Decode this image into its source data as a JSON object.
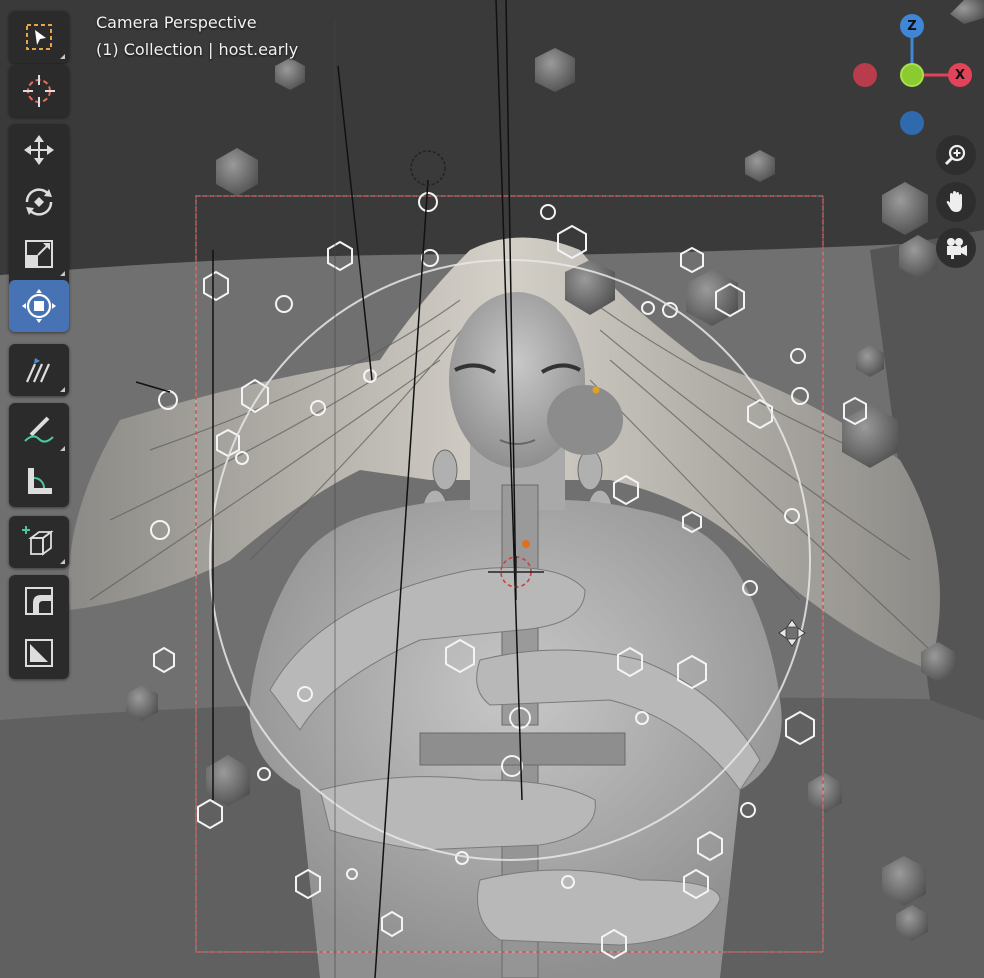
{
  "viewport": {
    "title": "Camera Perspective",
    "subtitle": "(1) Collection | host.early"
  },
  "toolbar": {
    "tools": [
      {
        "name": "select-box-tool",
        "icon": "select-box-icon",
        "active": false
      },
      {
        "name": "cursor-tool",
        "icon": "cursor-icon",
        "active": false
      },
      {
        "name": "move-tool",
        "icon": "move-icon",
        "active": false
      },
      {
        "name": "rotate-tool",
        "icon": "rotate-icon",
        "active": false
      },
      {
        "name": "scale-tool",
        "icon": "scale-icon",
        "active": false
      },
      {
        "name": "transform-tool",
        "icon": "transform-icon",
        "active": true
      },
      {
        "name": "hair-comb-tool",
        "icon": "comb-icon",
        "active": false
      },
      {
        "name": "annotate-tool",
        "icon": "annotate-icon",
        "active": false
      },
      {
        "name": "measure-tool",
        "icon": "measure-icon",
        "active": false
      },
      {
        "name": "add-cube-tool",
        "icon": "add-cube-icon",
        "active": false
      },
      {
        "name": "bevel-tool",
        "icon": "bevel-icon",
        "active": false
      },
      {
        "name": "shear-tool",
        "icon": "shear-icon",
        "active": false
      }
    ]
  },
  "gizmo": {
    "z_label": "Z",
    "x_label": "X",
    "colors": {
      "x": "#e0435a",
      "y": "#8bcb2f",
      "z": "#3f86d6"
    }
  },
  "nav_buttons": [
    {
      "name": "zoom-button",
      "icon": "zoom-in-icon"
    },
    {
      "name": "pan-button",
      "icon": "hand-icon"
    },
    {
      "name": "camera-view-button",
      "icon": "camera-icon"
    }
  ],
  "colors": {
    "active_tool": "#4772b3",
    "toolbar_bg": "#2b2b2b",
    "frame_border": "#c85050"
  }
}
